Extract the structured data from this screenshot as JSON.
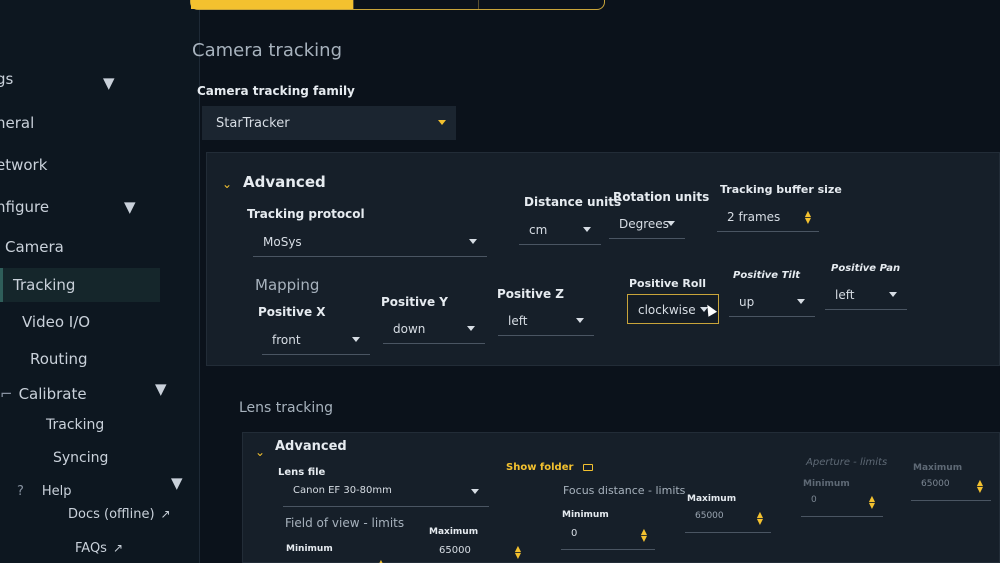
{
  "sidebar": {
    "items": [
      {
        "label": "gs"
      },
      {
        "label": "neral"
      },
      {
        "label": "etwork"
      },
      {
        "label": "nfigure"
      },
      {
        "label": "Camera"
      },
      {
        "label": "Tracking"
      },
      {
        "label": "Video I/O"
      },
      {
        "label": "Routing"
      },
      {
        "label": "Calibrate"
      },
      {
        "label": "Tracking"
      },
      {
        "label": "Syncing"
      },
      {
        "label": "Help"
      },
      {
        "label": "Docs (offline)"
      },
      {
        "label": "FAQs"
      }
    ],
    "help_mark": "?"
  },
  "camera_tracking": {
    "title": "Camera tracking",
    "family_label": "Camera tracking family",
    "family_value": "StarTracker",
    "advanced": {
      "title": "Advanced",
      "protocol_label": "Tracking protocol",
      "protocol_value": "MoSys",
      "distance_units_label": "Distance units",
      "distance_units_value": "cm",
      "rotation_units_label": "Rotation units",
      "rotation_units_value": "Degrees",
      "buffer_label": "Tracking buffer size",
      "buffer_value": "2 frames",
      "mapping_title": "Mapping",
      "mapping": [
        {
          "label": "Positive X",
          "value": "front"
        },
        {
          "label": "Positive Y",
          "value": "down"
        },
        {
          "label": "Positive Z",
          "value": "left"
        },
        {
          "label": "Positive Roll",
          "value": "clockwise"
        },
        {
          "label": "Positive Tilt",
          "value": "up"
        },
        {
          "label": "Positive Pan",
          "value": "left"
        }
      ]
    }
  },
  "lens_tracking": {
    "title": "Lens tracking",
    "advanced": {
      "title": "Advanced",
      "lens_file_label": "Lens file",
      "lens_file_value": "Canon EF 30-80mm",
      "show_folder": "Show folder",
      "fov": {
        "title": "Field of view - limits",
        "min_label": "Minimum",
        "max_label": "Maximum",
        "max_value": "65000"
      },
      "focus": {
        "title": "Focus distance - limits",
        "min_label": "Minimum",
        "min_value": "0",
        "max_label": "Maximum",
        "max_value": "65000"
      },
      "aperture": {
        "title": "Aperture - limits",
        "min_label": "Minimum",
        "min_value": "0",
        "max_label": "Maximum",
        "max_value": "65000"
      }
    }
  },
  "colors": {
    "accent": "#f3c12f",
    "background": "#0b121b",
    "panel": "#161f29"
  }
}
